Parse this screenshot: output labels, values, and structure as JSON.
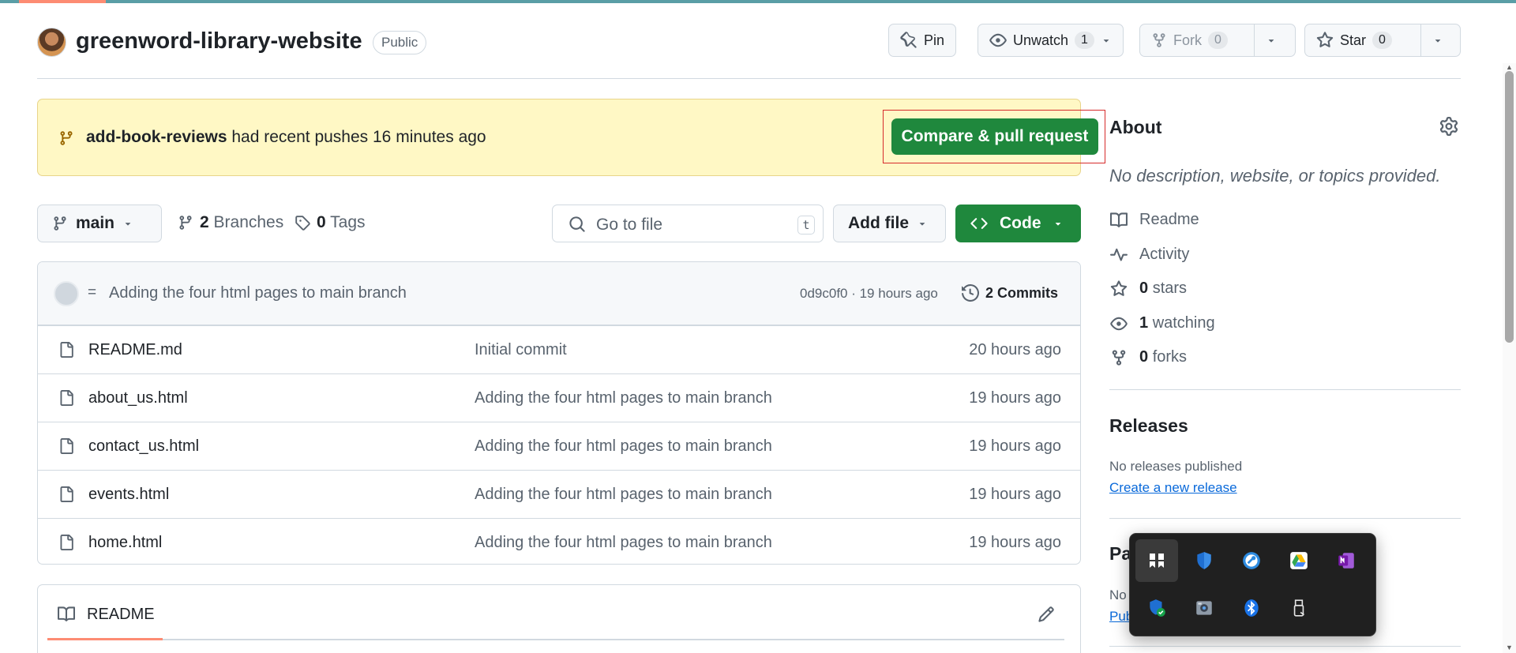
{
  "repo": {
    "name": "greenword-library-website",
    "visibility": "Public"
  },
  "header_actions": {
    "pin_label": "Pin",
    "unwatch_label": "Unwatch",
    "unwatch_count": "1",
    "fork_label": "Fork",
    "fork_count": "0",
    "star_label": "Star",
    "star_count": "0"
  },
  "banner": {
    "branch": "add-book-reviews",
    "text": " had recent pushes 16 minutes ago",
    "button_label": "Compare & pull request"
  },
  "toolbar": {
    "branch_label": "main",
    "branches_count": "2",
    "branches_label": " Branches",
    "tags_count": "0",
    "tags_label": " Tags",
    "search_placeholder": "Go to file",
    "search_shortcut": "t",
    "add_file_label": "Add file",
    "code_label": "Code"
  },
  "latest_commit": {
    "prefix": "=",
    "message": "Adding the four html pages to main branch",
    "meta": "0d9c0f0 · 19 hours ago",
    "commits_label": "2 Commits"
  },
  "files": [
    {
      "name": "README.md",
      "message": "Initial commit",
      "time": "20 hours ago"
    },
    {
      "name": "about_us.html",
      "message": "Adding the four html pages to main branch",
      "time": "19 hours ago"
    },
    {
      "name": "contact_us.html",
      "message": "Adding the four html pages to main branch",
      "time": "19 hours ago"
    },
    {
      "name": "events.html",
      "message": "Adding the four html pages to main branch",
      "time": "19 hours ago"
    },
    {
      "name": "home.html",
      "message": "Adding the four html pages to main branch",
      "time": "19 hours ago"
    }
  ],
  "readme": {
    "label": "README"
  },
  "about": {
    "title": "About",
    "description": "No description, website, or topics provided.",
    "readme": "Readme",
    "activity": "Activity",
    "stars_count": "0",
    "stars_label": "stars",
    "watching_count": "1",
    "watching_label": "watching",
    "forks_count": "0",
    "forks_label": "forks"
  },
  "releases": {
    "title": "Releases",
    "none": "No releases published",
    "create_link": "Create a new release"
  },
  "packages": {
    "title": "Pa",
    "none": "No",
    "link": "Pub"
  },
  "tray_icons": [
    "widget-icon",
    "defender-icon",
    "key-tool-icon",
    "google-drive-icon",
    "onenote-icon",
    "security-check-icon",
    "photo-app-icon",
    "bluetooth-icon",
    "usb-icon"
  ],
  "colors": {
    "primary_green": "#1f883d",
    "banner_bg": "#fff8c5",
    "link_blue": "#0969da",
    "accent_orange": "#fd8c73"
  }
}
